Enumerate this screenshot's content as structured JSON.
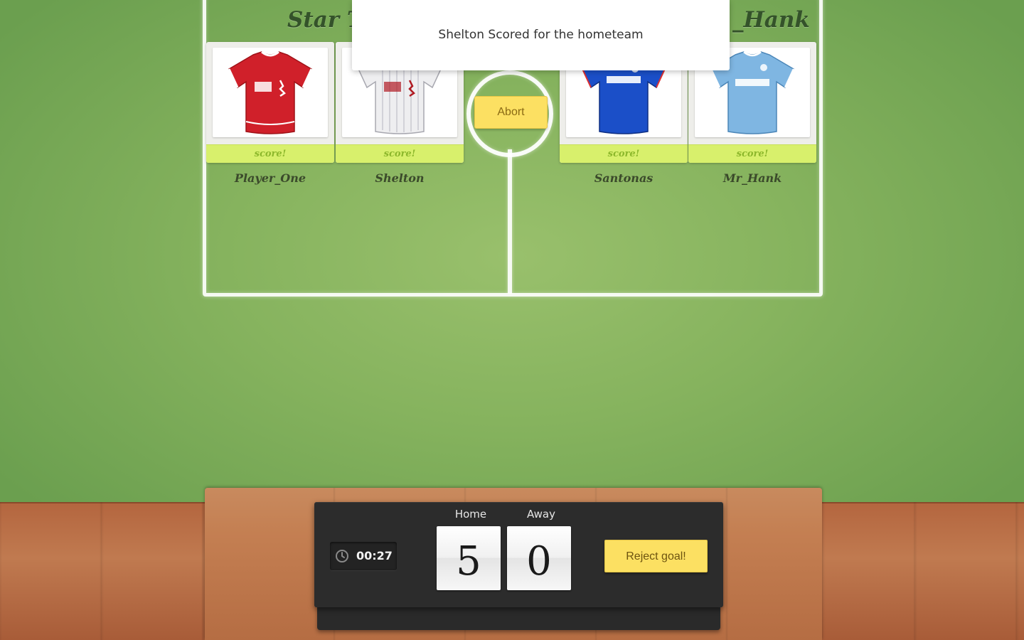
{
  "notification": {
    "message": "Shelton Scored for the hometeam"
  },
  "teams": {
    "home": {
      "title": "Star Te"
    },
    "away": {
      "title": "_Hank"
    }
  },
  "players": [
    {
      "name": "Player_One",
      "score_label": "score!",
      "jersey": {
        "name": "liverpool-home-jersey-icon",
        "color": "#d0202a"
      }
    },
    {
      "name": "Shelton",
      "score_label": "score!",
      "jersey": {
        "name": "liverpool-away-jersey-icon",
        "color": "#eeeef0"
      }
    },
    {
      "name": "Santonas",
      "score_label": "score!",
      "jersey": {
        "name": "chelsea-jersey-icon",
        "color": "#1b4fc8"
      }
    },
    {
      "name": "Mr_Hank",
      "score_label": "score!",
      "jersey": {
        "name": "mancity-jersey-icon",
        "color": "#7fb6e2"
      }
    }
  ],
  "controls": {
    "abort_label": "Abort",
    "reject_label": "Reject goal!"
  },
  "scoreboard": {
    "timer": "00:27",
    "home_label": "Home",
    "away_label": "Away",
    "home_score": "5",
    "away_score": "0"
  },
  "colors": {
    "button": "#fce062",
    "score_bar": "#d8f06c",
    "pitch": "#8fbb62",
    "board": "#2c2c2c"
  }
}
